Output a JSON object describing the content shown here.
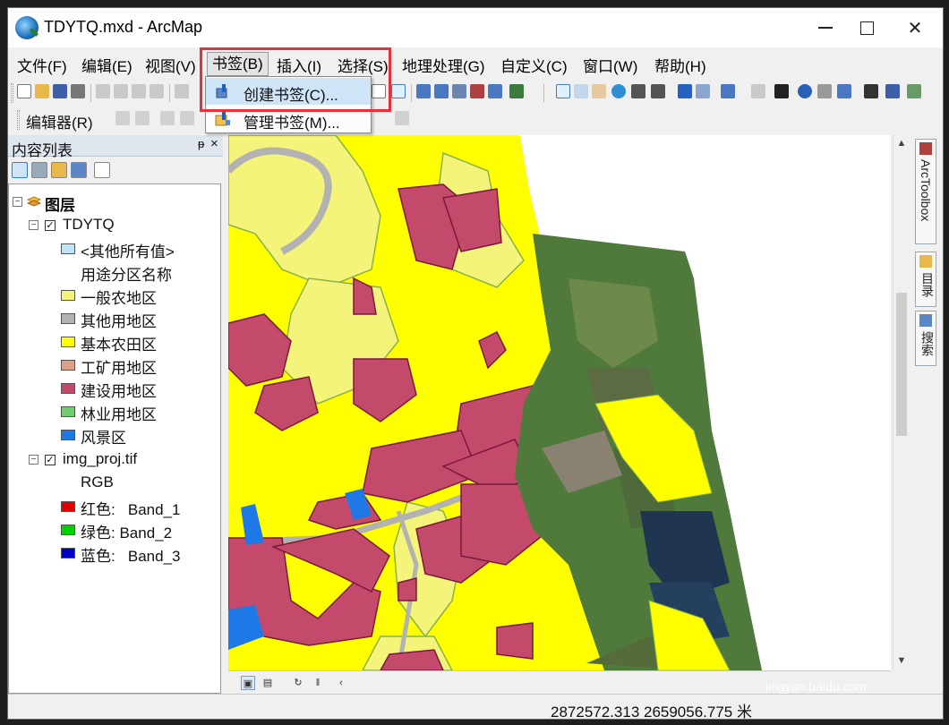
{
  "window": {
    "title": "TDYTQ.mxd - ArcMap"
  },
  "menubar": {
    "items": [
      "文件(F)",
      "编辑(E)",
      "视图(V)",
      "书签(B)",
      "插入(I)",
      "选择(S)",
      "地理处理(G)",
      "自定义(C)",
      "窗口(W)",
      "帮助(H)"
    ],
    "open_item": "书签(B)"
  },
  "bookmark_menu": {
    "items": [
      {
        "label": "创建书签(C)...",
        "icon": "bookmark-create-icon"
      },
      {
        "label": "管理书签(M)...",
        "icon": "bookmark-manage-icon"
      }
    ]
  },
  "editor_toolbar": {
    "label": "编辑器(R)"
  },
  "toc": {
    "title": "内容列表",
    "root": "图层",
    "layer1": {
      "name": "TDYTQ",
      "other_values": "<其他所有值>",
      "field": "用途分区名称",
      "classes": [
        {
          "label": "一般农地区",
          "color": "#f4f47a"
        },
        {
          "label": "其他用地区",
          "color": "#b2b2b2"
        },
        {
          "label": "基本农田区",
          "color": "#ffff00"
        },
        {
          "label": "工矿用地区",
          "color": "#d9a08a"
        },
        {
          "label": "建设用地区",
          "color": "#c44a6c"
        },
        {
          "label": "林业用地区",
          "color": "#6fcf6f"
        },
        {
          "label": "风景区",
          "color": "#1e78e6"
        }
      ],
      "other_color": "#bfe3f5"
    },
    "layer2": {
      "name": "img_proj.tif",
      "subtitle": "RGB",
      "bands": [
        {
          "label": "红色:   Band_1",
          "color": "#e00000"
        },
        {
          "label": "绿色: Band_2",
          "color": "#00d000"
        },
        {
          "label": "蓝色:   Band_3",
          "color": "#0000c8"
        }
      ]
    }
  },
  "right_dock": {
    "tabs": [
      "ArcToolbox",
      "目录",
      "搜索"
    ]
  },
  "status": {
    "coordinates": "2872572.313  2659056.775 米"
  },
  "watermark": {
    "brand": "Bai 经验",
    "url": "jingyan.baidu.com"
  },
  "colors": {
    "highlight": "#e8303a",
    "farmland": "#ffff00",
    "general_farm": "#f4f47a",
    "construction": "#c44a6c",
    "road": "#b2b2b2",
    "scenic": "#1e78e6"
  }
}
